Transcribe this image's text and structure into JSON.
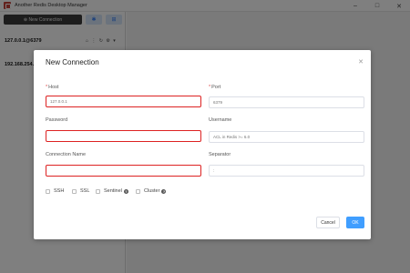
{
  "window": {
    "title": "Another Redis Desktop Manager",
    "minimize": "–",
    "maximize": "□",
    "close": "✕"
  },
  "sidebar": {
    "new_connection_label": "⊕ New Connection",
    "settings_icon": "✱",
    "grid_icon": "⊞",
    "connections": [
      {
        "label": "127.0.0.1@6379",
        "icons": "⌂ ⋮ ↻ ⚙ ▾"
      },
      {
        "label": "192.168.254."
      }
    ]
  },
  "dialog": {
    "title": "New Connection",
    "close": "✕",
    "host": {
      "required": "*",
      "label": "Host",
      "placeholder": "127.0.0.1"
    },
    "port": {
      "required": "*",
      "label": "Port",
      "placeholder": "6379"
    },
    "password": {
      "label": "Password",
      "placeholder": ""
    },
    "username": {
      "label": "Username",
      "placeholder": "ACL in Redis >= 6.0"
    },
    "connection_name": {
      "label": "Connection Name",
      "placeholder": ""
    },
    "separator": {
      "label": "Separator",
      "placeholder": ":"
    },
    "options": [
      {
        "label": "SSH",
        "help": false
      },
      {
        "label": "SSL",
        "help": false
      },
      {
        "label": "Sentinel",
        "help": true
      },
      {
        "label": "Cluster",
        "help": true
      }
    ],
    "help_glyph": "?",
    "cancel_label": "Cancel",
    "ok_label": "OK"
  },
  "colors": {
    "highlight": "#dd2222",
    "primary": "#409eff"
  }
}
